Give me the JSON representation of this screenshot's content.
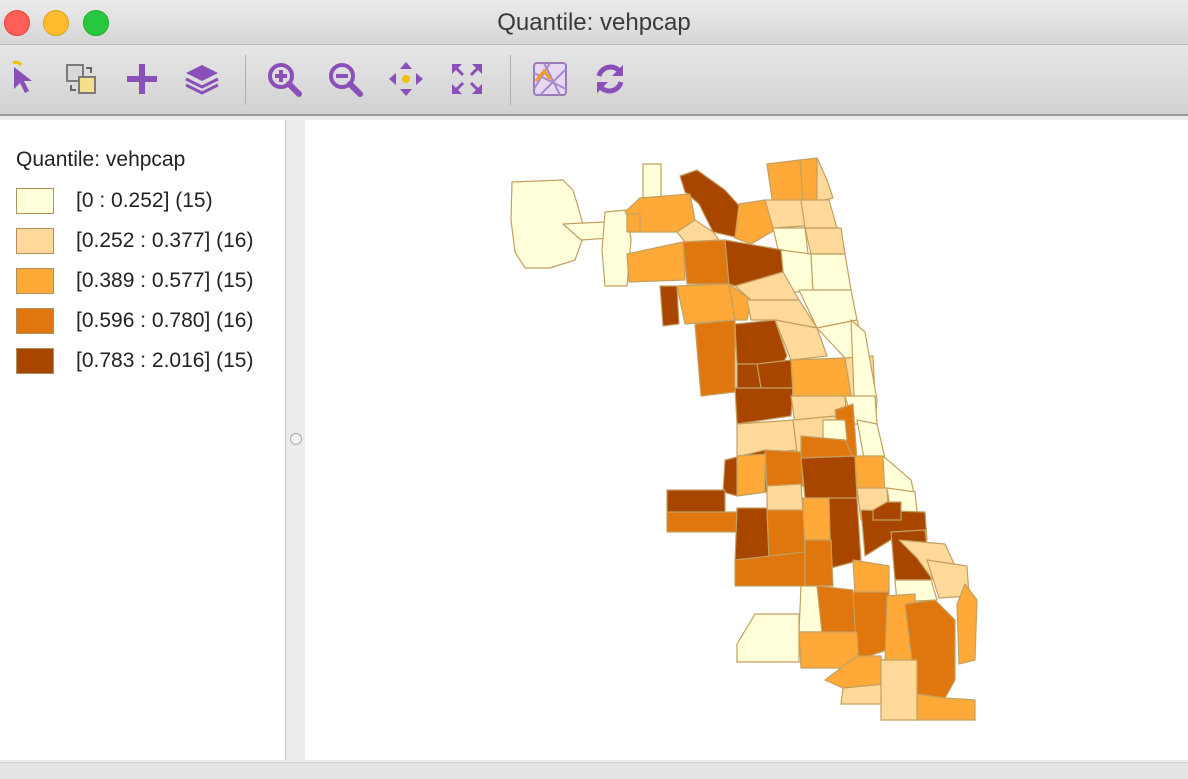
{
  "window": {
    "title": "Quantile: vehpcap"
  },
  "toolbar": {
    "tools": [
      {
        "name": "select-tool",
        "icon": "select-arrow-icon"
      },
      {
        "name": "selection-shape-tool",
        "icon": "select-shape-icon"
      },
      {
        "name": "add-tool",
        "icon": "plus-icon"
      },
      {
        "name": "layers-tool",
        "icon": "layers-icon"
      },
      {
        "name": "zoom-in-tool",
        "icon": "zoom-in-icon"
      },
      {
        "name": "zoom-out-tool",
        "icon": "zoom-out-icon"
      },
      {
        "name": "pan-tool",
        "icon": "pan-arrows-icon"
      },
      {
        "name": "full-extent-tool",
        "icon": "full-extent-icon"
      },
      {
        "name": "basemap-tool",
        "icon": "basemap-icon"
      },
      {
        "name": "refresh-tool",
        "icon": "refresh-icon"
      }
    ],
    "icon_color": "#8a4fb8"
  },
  "legend": {
    "title": "Quantile: vehpcap",
    "classes": [
      {
        "label": "[0 : 0.252] (15)",
        "color": "#ffffd9"
      },
      {
        "label": "[0.252 : 0.377] (16)",
        "color": "#fed99a"
      },
      {
        "label": "[0.389 : 0.577] (15)",
        "color": "#fea938"
      },
      {
        "label": "[0.596 : 0.780] (16)",
        "color": "#e0760e"
      },
      {
        "label": "[0.783 : 2.016] (15)",
        "color": "#a84600"
      }
    ]
  }
}
